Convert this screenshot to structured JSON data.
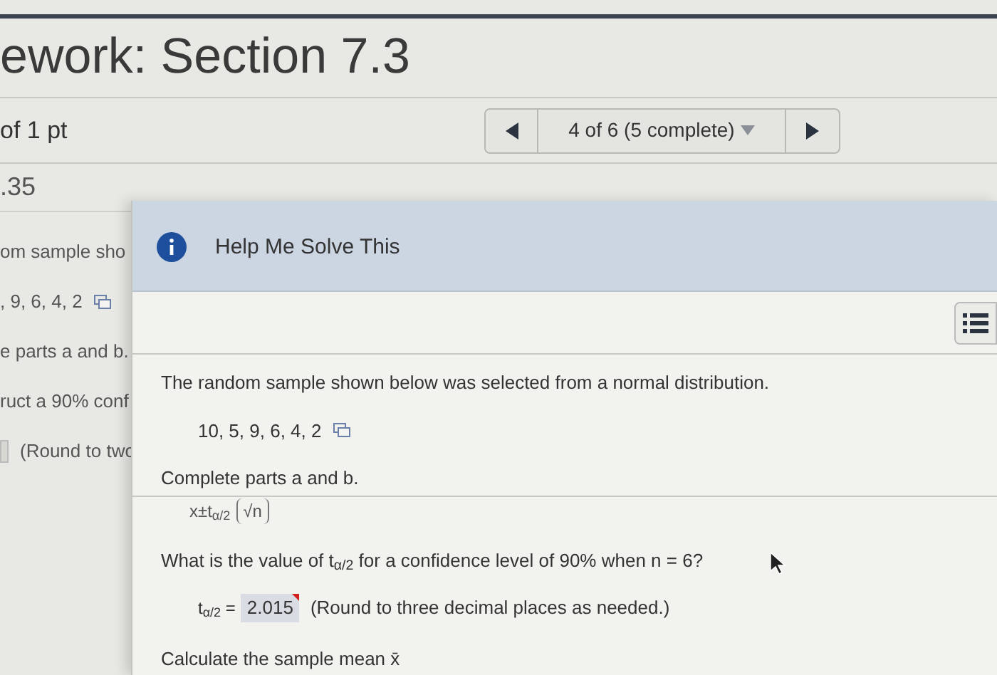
{
  "header": {
    "title": "ework: Section 7.3"
  },
  "question_bar": {
    "points": "of 1 pt",
    "pager": {
      "label": "4 of 6 (5 complete)"
    }
  },
  "score": ".35",
  "background_lines": [
    {
      "kind": "text",
      "text": "om sample sho"
    },
    {
      "kind": "data",
      "text": ", 9, 6, 4, 2"
    },
    {
      "kind": "text",
      "text": "e parts a and b."
    },
    {
      "kind": "text",
      "text": "ruct a 90% conf"
    },
    {
      "kind": "answer",
      "text": "(Round to two"
    }
  ],
  "help_panel": {
    "title": "Help Me Solve This",
    "intro": "The random sample shown below was selected from a normal distribution.",
    "data": "10, 5, 9, 6, 4, 2",
    "instruction": "Complete parts a and b.",
    "formula": {
      "lhs": "x±t$_{α/2}$",
      "root": "√n"
    },
    "question": "What is the value of t$_{α/2}$ for a confidence level of 90% when n = 6?",
    "answer": {
      "label": "t$_{α/2}$ =",
      "value": "2.015",
      "flagged": true,
      "hint": "(Round to three decimal places as needed.)"
    },
    "next": "Calculate the sample mean x̄"
  }
}
